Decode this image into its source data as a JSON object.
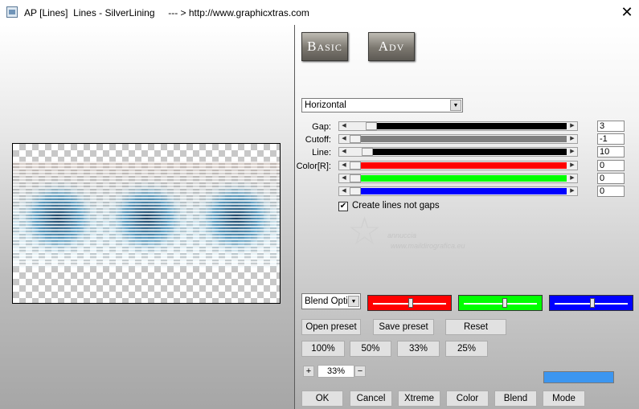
{
  "window": {
    "title": "AP [Lines]  Lines - SilverLining     --- > http://www.graphicxtras.com",
    "close_glyph": "✕"
  },
  "tabs": [
    {
      "label": "Basic"
    },
    {
      "label": "Adv"
    }
  ],
  "direction_dropdown": {
    "value": "Horizontal",
    "arrow": "▼"
  },
  "sliders": [
    {
      "label": "Gap:",
      "value": "3",
      "fill_color": "#000000",
      "position": 0.08
    },
    {
      "label": "Cutoff:",
      "value": "-1",
      "fill_color": "#7f7f7f",
      "position": 0.0
    },
    {
      "label": "Line:",
      "value": "10",
      "fill_color": "#000000",
      "position": 0.06
    },
    {
      "label": "Color[R]:",
      "value": "0",
      "fill_color": "#ff0000",
      "position": 0.0
    },
    {
      "label": "",
      "value": "0",
      "fill_color": "#00ff00",
      "position": 0.0
    },
    {
      "label": "",
      "value": "0",
      "fill_color": "#0000ff",
      "position": 0.0
    }
  ],
  "slider_arrows": {
    "left": "◀",
    "right": "▶"
  },
  "checkbox": {
    "label": "Create lines not gaps",
    "checked": true,
    "glyph": "✔"
  },
  "watermark": {
    "line1": "annuccia",
    "line2": "www.maildirografica.eu"
  },
  "blend_dropdown": {
    "value": "Blend Optio",
    "arrow": "▼"
  },
  "color_sliders": [
    {
      "color": "#ff0000",
      "position": 0.5
    },
    {
      "color": "#00ff00",
      "position": 0.55
    },
    {
      "color": "#0000ff",
      "position": 0.5
    }
  ],
  "buttons": {
    "open_preset": "Open preset",
    "save_preset": "Save preset",
    "reset": "Reset",
    "zoom_100": "100%",
    "zoom_50": "50%",
    "zoom_33": "33%",
    "zoom_25": "25%",
    "ok": "OK",
    "cancel": "Cancel",
    "xtreme": "Xtreme",
    "color": "Color",
    "blend": "Blend",
    "mode": "Mode"
  },
  "zoom": {
    "plus": "+",
    "value": "33%",
    "minus": "−"
  },
  "color_preview": {
    "color": "#3c96f0"
  }
}
